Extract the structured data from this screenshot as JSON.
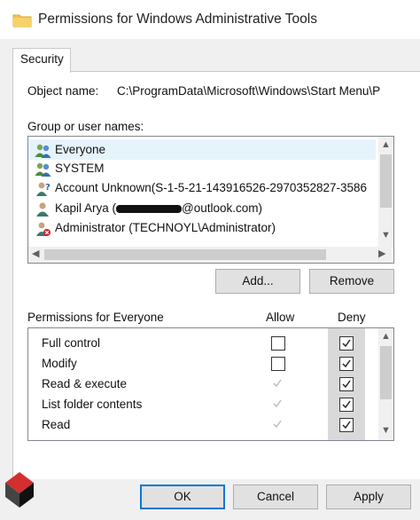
{
  "window": {
    "title": "Permissions for Windows Administrative Tools"
  },
  "tabs": [
    {
      "label": "Security",
      "active": true
    }
  ],
  "object": {
    "label": "Object name:",
    "value": "C:\\ProgramData\\Microsoft\\Windows\\Start Menu\\P"
  },
  "groups": {
    "label": "Group or user names:",
    "items": [
      {
        "name": "Everyone",
        "icon": "user-group-icon",
        "selected": true
      },
      {
        "name": "SYSTEM",
        "icon": "user-group-icon"
      },
      {
        "name": "Account Unknown(S-1-5-21-143916526-2970352827-3586",
        "icon": "unknown-user-icon"
      },
      {
        "name": "Kapil Arya (",
        "redacted": true,
        "suffix": "@outlook.com)",
        "icon": "user-icon"
      },
      {
        "name": "Administrator (TECHNOYL\\Administrator)",
        "icon": "admin-user-icon"
      }
    ]
  },
  "buttons": {
    "add": "Add...",
    "remove": "Remove",
    "ok": "OK",
    "cancel": "Cancel",
    "apply": "Apply"
  },
  "permissions": {
    "label": "Permissions for Everyone",
    "allow_label": "Allow",
    "deny_label": "Deny",
    "rows": [
      {
        "name": "Full control",
        "allow": false,
        "allow_disabled": false,
        "deny": true
      },
      {
        "name": "Modify",
        "allow": false,
        "allow_disabled": false,
        "deny": true
      },
      {
        "name": "Read & execute",
        "allow": true,
        "allow_disabled": true,
        "deny": true
      },
      {
        "name": "List folder contents",
        "allow": true,
        "allow_disabled": true,
        "deny": true
      },
      {
        "name": "Read",
        "allow": true,
        "allow_disabled": true,
        "deny": true
      }
    ]
  },
  "colors": {
    "accent": "#0078d7",
    "selection": "#e5f3fb",
    "deny_column": "#d9d9d9"
  }
}
